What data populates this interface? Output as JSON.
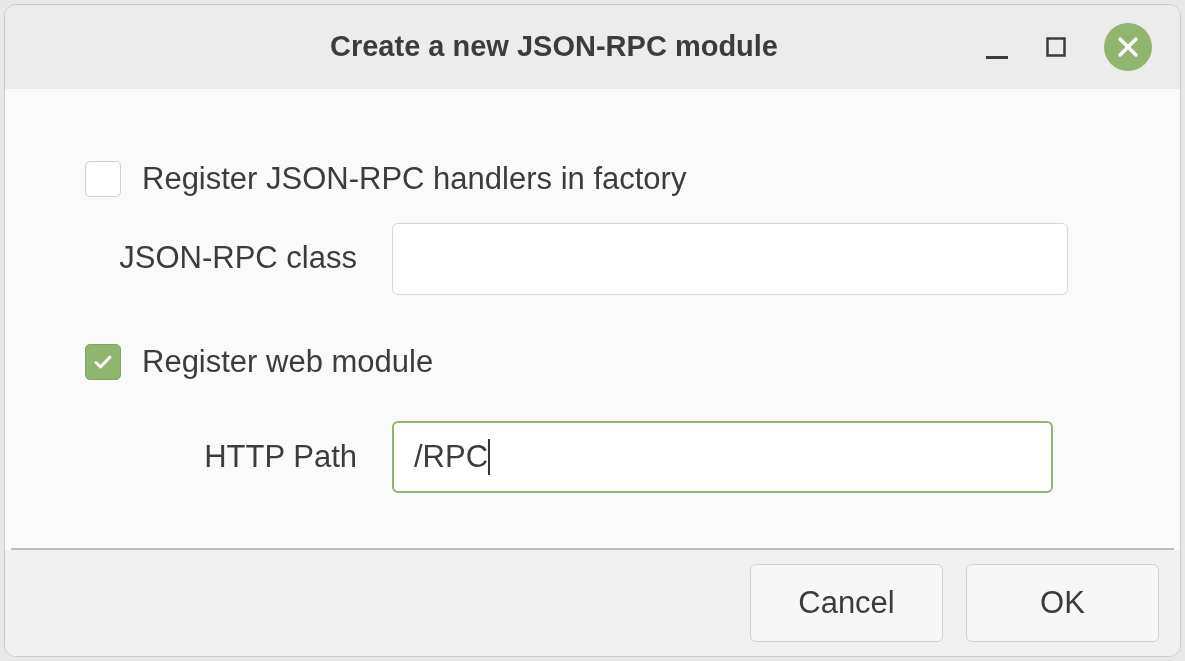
{
  "window": {
    "title": "Create a new JSON-RPC module"
  },
  "rows": [
    {
      "kind": "checkbox",
      "label": "Register JSON-RPC handlers in factory",
      "checked": false
    },
    {
      "kind": "field",
      "label": "JSON-RPC class",
      "focused": false
    },
    {
      "kind": "checkbox",
      "label": "Register web module",
      "checked": true
    },
    {
      "kind": "field",
      "label": "HTTP Path",
      "value": "/RPC",
      "focused": true
    }
  ],
  "buttons": [
    "Cancel",
    "OK"
  ]
}
